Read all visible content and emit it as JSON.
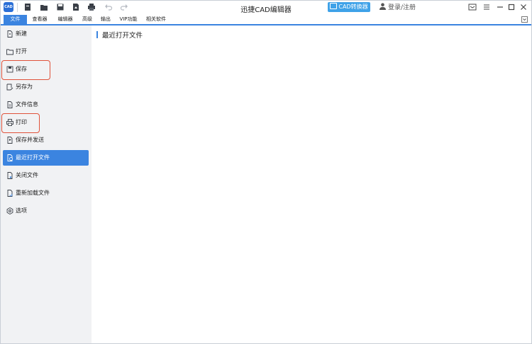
{
  "window": {
    "title": "迅捷CAD编辑器",
    "logo_text": "CAD",
    "cad_converter_label": "CAD转换器",
    "login_label": "登录/注册",
    "accent_color": "#3b84e0",
    "converter_color": "#3fa2e8",
    "highlight_color": "#e0523a"
  },
  "quick_access": [
    "new-file-icon",
    "open-folder-icon",
    "save-icon",
    "export-pdf-icon",
    "print-icon",
    "undo-icon",
    "redo-icon"
  ],
  "menu": {
    "tabs": [
      {
        "label": "文件",
        "active": true
      },
      {
        "label": "查看器"
      },
      {
        "label": "编辑器"
      },
      {
        "label": "高级"
      },
      {
        "label": "输出"
      },
      {
        "label": "VIP功能"
      },
      {
        "label": "相关软件"
      }
    ]
  },
  "sidebar": {
    "items": [
      {
        "label": "新建",
        "icon": "new-file-icon"
      },
      {
        "label": "打开",
        "icon": "open-folder-icon"
      },
      {
        "label": "保存",
        "icon": "save-icon",
        "highlighted": true
      },
      {
        "label": "另存为",
        "icon": "save-as-icon"
      },
      {
        "label": "文件信息",
        "icon": "file-info-icon"
      },
      {
        "label": "打印",
        "icon": "print-icon",
        "highlighted": true
      },
      {
        "label": "保存并发送",
        "icon": "save-send-icon"
      },
      {
        "label": "最近打开文件",
        "icon": "recent-files-icon",
        "selected": true
      },
      {
        "label": "关闭文件",
        "icon": "close-file-icon"
      },
      {
        "label": "重新加载文件",
        "icon": "reload-file-icon"
      },
      {
        "label": "选项",
        "icon": "options-gear-icon"
      }
    ]
  },
  "main": {
    "section_title": "最近打开文件"
  }
}
